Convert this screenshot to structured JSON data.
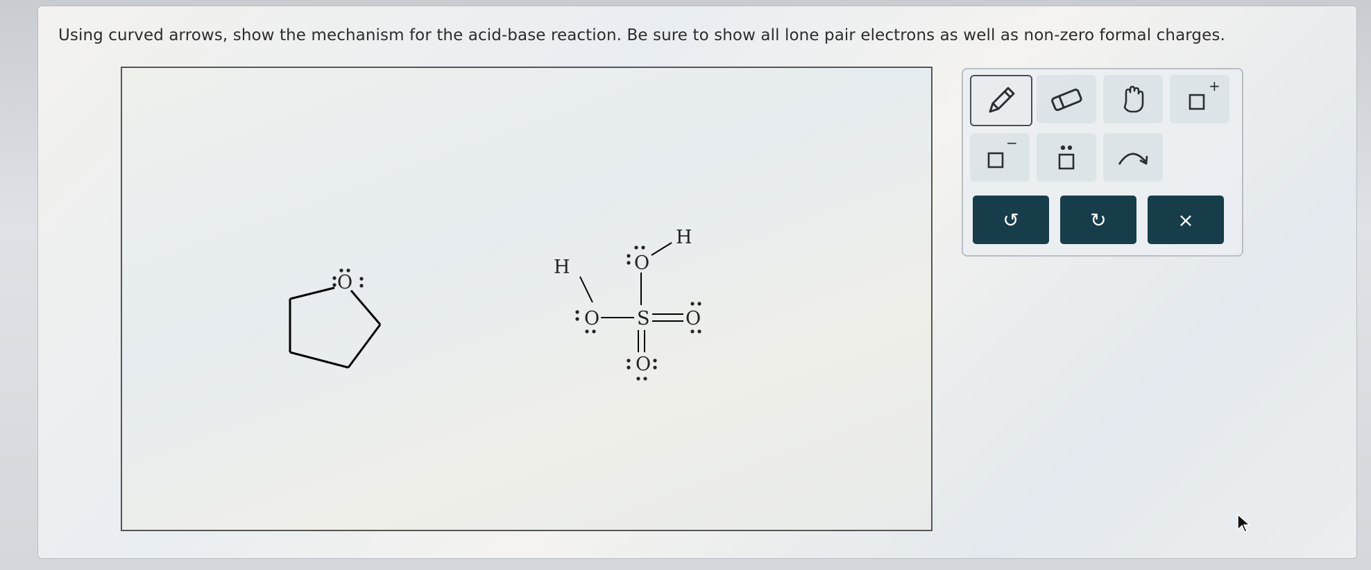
{
  "question": {
    "instruction": "Using curved arrows, show the mechanism for the acid-base reaction. Be sure to show all lone pair electrons as well as non-zero formal charges."
  },
  "molecules": {
    "thf": {
      "oxygen": "O"
    },
    "sulfuric_acid": {
      "sulfur": "S",
      "oxygen_top": "O",
      "oxygen_left": "O",
      "oxygen_right": "O",
      "oxygen_bottom": "O",
      "hydrogen_top": "H",
      "hydrogen_left": "H"
    }
  },
  "toolbar": {
    "tools": [
      {
        "name": "pencil-tool",
        "icon": "pencil-icon",
        "selected": true
      },
      {
        "name": "eraser-tool",
        "icon": "eraser-icon",
        "selected": false
      },
      {
        "name": "hand-tool",
        "icon": "hand-icon",
        "selected": false
      },
      {
        "name": "positive-charge-tool",
        "icon": "box-plus-icon",
        "superscript": "+"
      },
      {
        "name": "negative-charge-tool",
        "icon": "box-minus-icon",
        "superscript": "−"
      },
      {
        "name": "lone-pair-tool",
        "icon": "box-dots-icon"
      },
      {
        "name": "curved-arrow-tool",
        "icon": "curved-arrow-icon"
      }
    ],
    "actions": {
      "undo_symbol": "↺",
      "redo_symbol": "↻",
      "clear_symbol": "×"
    }
  },
  "colors": {
    "action_button_bg": "#173d4b",
    "toolbar_border": "#b9bec4"
  }
}
